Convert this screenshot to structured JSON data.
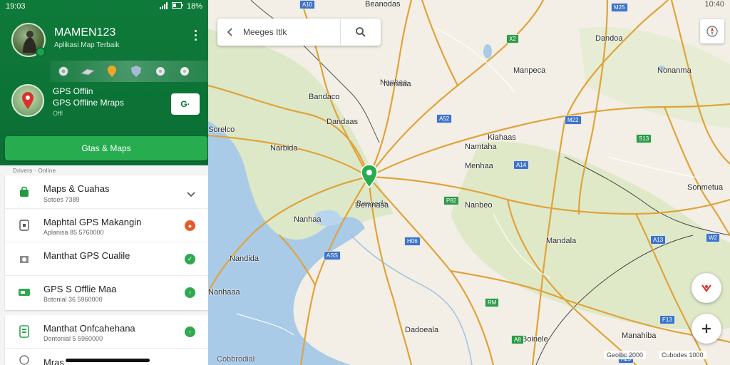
{
  "status_bar": {
    "time": "19:03",
    "battery": "18%"
  },
  "map_status": "10:40",
  "profile": {
    "name": "MAMEN123",
    "subtitle": "Aplikasi Map Terbaik"
  },
  "app_card": {
    "line1": "GPS Offlin",
    "line2": "GPS Offline Mraps",
    "line3": "Offl",
    "open_label": "G·"
  },
  "primary_button": "Gtas & Maps",
  "section_label": "Drivers · Online",
  "category": {
    "title": "Maps & Cuahas",
    "sub": "Sotoes 7389"
  },
  "list": [
    {
      "title": "Maphtal GPS Makangin",
      "sub": "Aplanisa 85 5760000",
      "badge_color": "#e55a2b",
      "badge_glyph": "●"
    },
    {
      "title": "Manthat GPS Cualile",
      "sub": "",
      "badge_color": "#2fa84f",
      "badge_glyph": "✓"
    },
    {
      "title": "GPS S Offlie Maa",
      "sub": "Botonial 36 5960000",
      "badge_color": "#2fa84f",
      "badge_glyph": "↑"
    },
    {
      "title": "Manthat Onfcahehana",
      "sub": "Dontonial 5 5960000",
      "badge_color": "#2fa84f",
      "badge_glyph": "↑"
    },
    {
      "title": "Mras",
      "sub": "",
      "badge_color": "#2fa84f",
      "badge_glyph": ""
    }
  ],
  "search": {
    "query": "Meeges Itlk"
  },
  "attribution": "Cobbrodial",
  "scale_labels": [
    "Geolbc 2000",
    "Cubodes 1000"
  ],
  "places": [
    "Nenhaa",
    "Bandaco",
    "Dandaas",
    "Narbida",
    "Sorelco",
    "Nanhaa",
    "Banasda",
    "Manpeca",
    "Namtaha",
    "Kiahaas",
    "Menhaa",
    "Nanbeo",
    "Mandala",
    "Dadoeala",
    "Nandida",
    "Sonmetua",
    "Dandoa",
    "Nenaaa",
    "Beanodas",
    "Nonanma",
    "Nanhaaa",
    "Demnasa",
    "Manahiba",
    "Boinele"
  ],
  "route_shields": [
    {
      "text": "A10",
      "color": "blue"
    },
    {
      "text": "X2",
      "color": "green"
    },
    {
      "text": "M25",
      "color": "blue"
    },
    {
      "text": "A52",
      "color": "blue"
    },
    {
      "text": "M22",
      "color": "blue"
    },
    {
      "text": "S13",
      "color": "green"
    },
    {
      "text": "A14",
      "color": "blue"
    },
    {
      "text": "H06",
      "color": "blue"
    },
    {
      "text": "P82",
      "color": "green"
    },
    {
      "text": "ASS",
      "color": "blue"
    },
    {
      "text": "A13",
      "color": "blue"
    },
    {
      "text": "W2",
      "color": "blue"
    },
    {
      "text": "A29",
      "color": "blue"
    },
    {
      "text": "RM",
      "color": "green"
    },
    {
      "text": "F13",
      "color": "blue"
    },
    {
      "text": "A8",
      "color": "green"
    }
  ],
  "colors": {
    "brand_green": "#0b6e34",
    "accent_green": "#27ad4f",
    "road": "#e0a33a",
    "water": "#a9cbe8"
  }
}
